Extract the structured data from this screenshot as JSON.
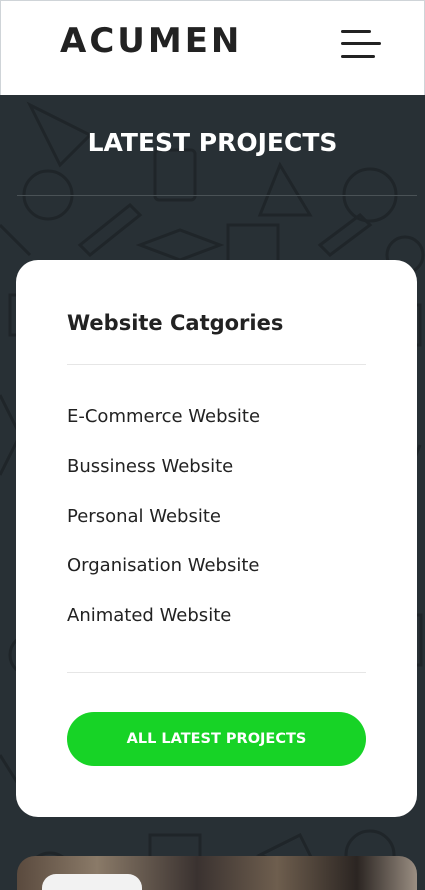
{
  "header": {
    "brand": "ACUMEN",
    "menu_icon": "hamburger-menu-icon"
  },
  "section": {
    "title": "LATEST PROJECTS"
  },
  "card": {
    "title": "Website Catgories",
    "categories": [
      "E-Commerce Website",
      "Bussiness Website",
      "Personal Website",
      "Organisation Website",
      "Animated Website"
    ],
    "button_label": "ALL LATEST PROJECTS"
  },
  "colors": {
    "accent": "#17d326",
    "background": "#283035",
    "text": "#222222"
  }
}
